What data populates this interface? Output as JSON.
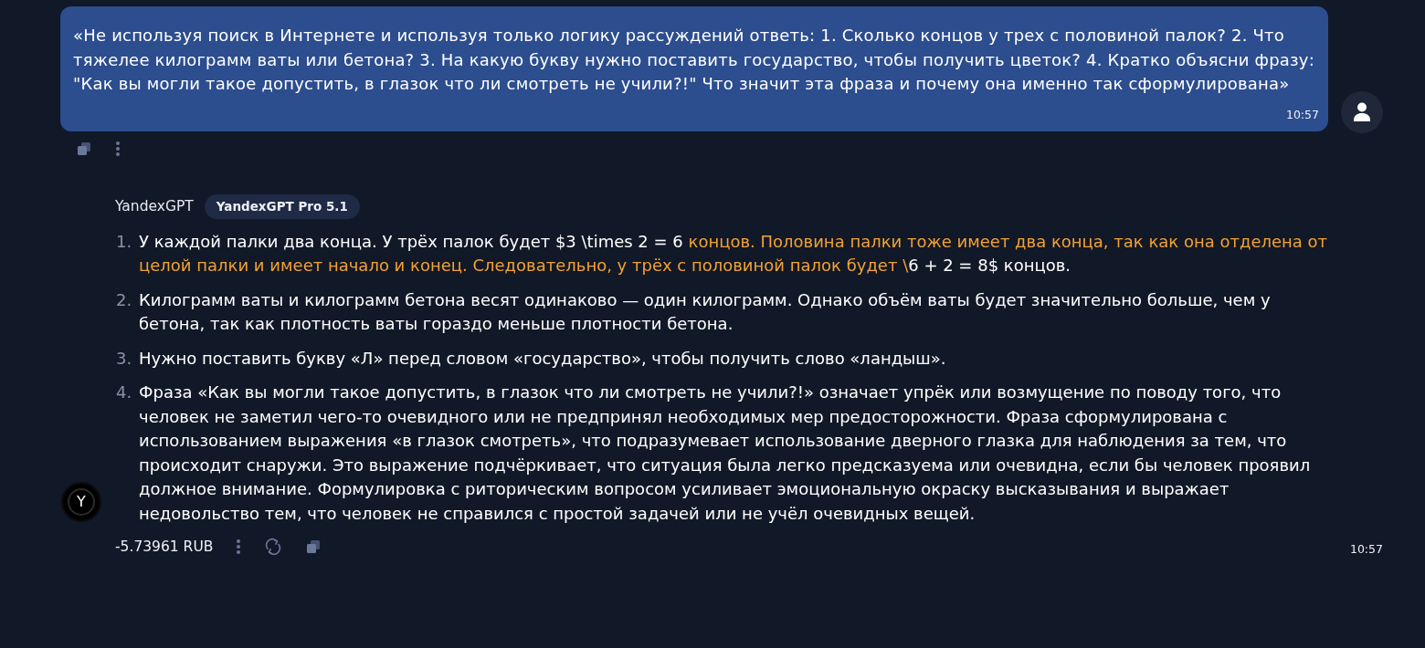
{
  "user_message": {
    "text": "«Не используя поиск в Интернете и используя только логику рассуждений ответь: 1. Сколько концов у трех с половиной палок? 2. Что тяжелее килограмм ваты или бетона? 3. На какую букву нужно поставить государство, чтобы получить цветок? 4. Кратко объясни фразу: \"Как вы могли такое допустить, в глазок что ли смотреть не учили?!\" Что значит эта фраза и почему она именно так сформулирована»",
    "time": "10:57"
  },
  "bot_message": {
    "avatar_letter": "Y",
    "sender": "YandexGPT",
    "model_badge": "YandexGPT Pro 5.1",
    "items": [
      {
        "number": "1.",
        "segments": [
          {
            "kind": "plain",
            "text": "У каждой палки два конца. У трёх палок будет $3 \\times 2 = 6 "
          },
          {
            "kind": "highlight",
            "text": "концов. Половина палки тоже имеет два конца, так как она отделена от целой палки и имеет начало и конец. Следовательно, у трёх с половиной палок будет \\"
          },
          {
            "kind": "plain",
            "text": "6 + 2 = 8$ концов."
          }
        ]
      },
      {
        "number": "2.",
        "segments": [
          {
            "kind": "plain",
            "text": "Килограмм ваты и килограмм бетона весят одинаково — один килограмм. Однако объём ваты будет значительно больше, чем у бетона, так как плотность ваты гораздо меньше плотности бетона."
          }
        ]
      },
      {
        "number": "3.",
        "segments": [
          {
            "kind": "plain",
            "text": "Нужно поставить букву «Л» перед словом «государство», чтобы получить слово «ландыш»."
          }
        ]
      },
      {
        "number": "4.",
        "segments": [
          {
            "kind": "plain",
            "text": "Фраза «Как вы могли такое допустить, в глазок что ли смотреть не учили?!» означает упрёк или возмущение по поводу того, что человек не заметил чего-то очевидного или не предпринял необходимых мер предосторожности. Фраза сформулирована с использованием выражения «в глазок смотреть», что подразумевает использование дверного глазка для наблюдения за тем, что происходит снаружи. Это выражение подчёркивает, что ситуация была легко предсказуема или очевидна, если бы человек проявил должное внимание. Формулировка с риторическим вопросом усиливает эмоциональную окраску высказывания и выражает недовольство тем, что человек не справился с простой задачей или не учёл очевидных вещей."
          }
        ]
      }
    ],
    "cost": "-5.73961 RUB",
    "time": "10:57"
  }
}
